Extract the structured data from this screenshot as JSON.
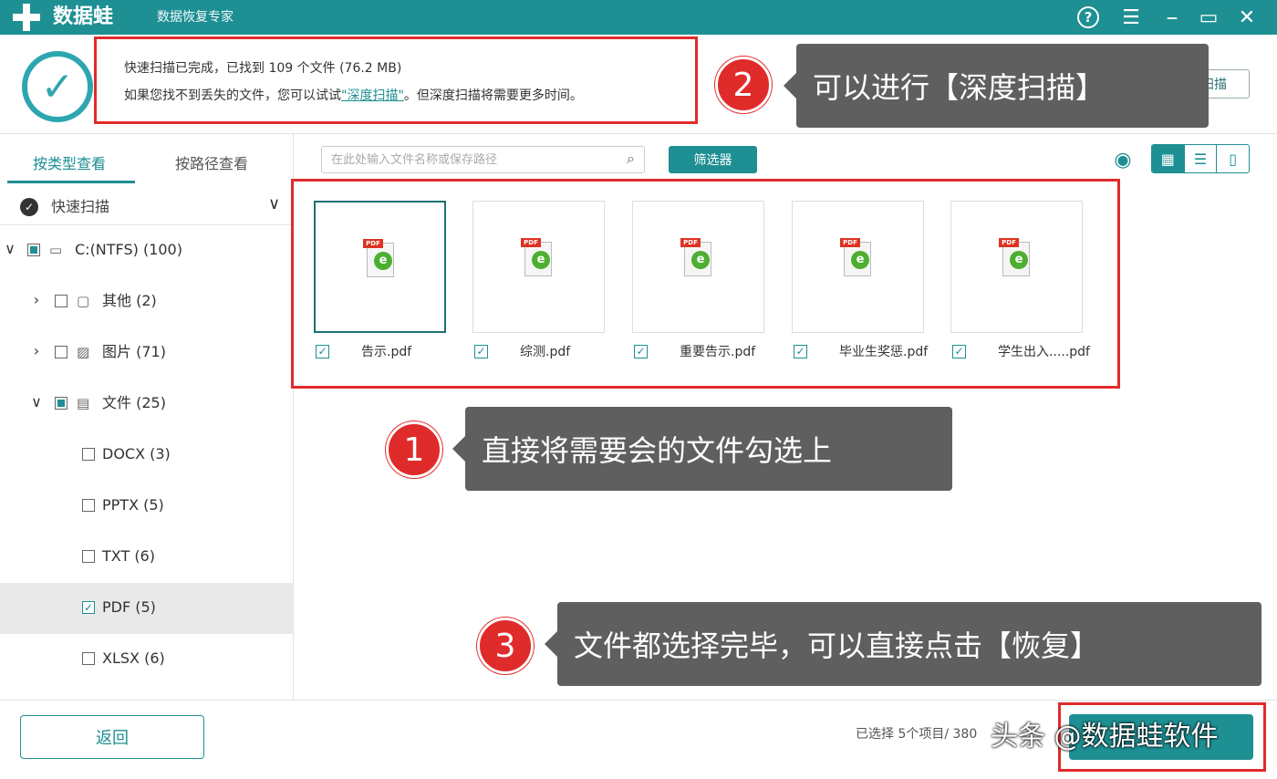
{
  "titlebar": {
    "app_name": "数据蛙",
    "subtitle": "数据恢复专家",
    "help_glyph": "?",
    "menu_glyph": "☰",
    "min_glyph": "–",
    "max_glyph": "▭",
    "close_glyph": "✕"
  },
  "status": {
    "line1": "快速扫描已完成，已找到 109 个文件 (76.2 MB)",
    "line2_prefix": "如果您找不到丢失的文件，您可以试试",
    "line2_link": "\"深度扫描\"",
    "line2_suffix": "。但深度扫描将需要更多时间。",
    "deep_scan_button": "深度扫描"
  },
  "sidebar": {
    "tab_by_type": "按类型查看",
    "tab_by_path": "按路径查看",
    "quick_scan": "快速扫描",
    "tree": [
      {
        "label": "C:(NTFS) (100)",
        "arrow": "∨",
        "state": "partial",
        "icon": "▭",
        "level": 0
      },
      {
        "label": "其他 (2)",
        "arrow": "›",
        "state": "empty",
        "icon": "▢",
        "level": 1
      },
      {
        "label": "图片 (71)",
        "arrow": "›",
        "state": "empty",
        "icon": "▨",
        "level": 1
      },
      {
        "label": "文件 (25)",
        "arrow": "∨",
        "state": "partial",
        "icon": "▤",
        "level": 1
      },
      {
        "label": "DOCX (3)",
        "state": "empty",
        "level": 2
      },
      {
        "label": "PPTX (5)",
        "state": "empty",
        "level": 2
      },
      {
        "label": "TXT (6)",
        "state": "empty",
        "level": 2
      },
      {
        "label": "PDF (5)",
        "state": "checked",
        "level": 2,
        "selected": true
      },
      {
        "label": "XLSX (6)",
        "state": "empty",
        "level": 2
      }
    ]
  },
  "toolbar": {
    "search_placeholder": "在此处输入文件名称或保存路径",
    "filter_button": "筛选器"
  },
  "files": [
    {
      "name": "告示.pdf",
      "checked": true,
      "active": true
    },
    {
      "name": "综测.pdf",
      "checked": true
    },
    {
      "name": "重要告示.pdf",
      "checked": true
    },
    {
      "name": "毕业生奖惩.pdf",
      "checked": true
    },
    {
      "name": "学生出入.....pdf",
      "checked": true
    }
  ],
  "callouts": {
    "c1_num": "1",
    "c1_text": "直接将需要会的文件勾选上",
    "c2_num": "2",
    "c2_text": "可以进行【深度扫描】",
    "c3_num": "3",
    "c3_text": "文件都选择完毕，可以直接点击【恢复】"
  },
  "footer": {
    "back_button": "返回",
    "selected_text": "已选择 5个项目/ 380",
    "watermark": "头条 @数据蛙软件"
  },
  "colors": {
    "teal": "#1e8f93",
    "red": "#e02b2b",
    "bubble": "#5f5f5f"
  }
}
